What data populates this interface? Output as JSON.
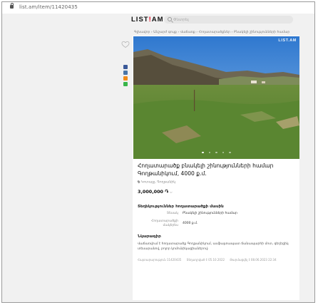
{
  "browser": {
    "url": "list.am/item/11420435"
  },
  "header": {
    "logo_main": "LIST",
    "logo_excl": "!",
    "logo_end": "AM",
    "search_placeholder": "Փնտրել"
  },
  "breadcrumb": "Գլխավոր › Անշարժ գույք › Վաճառք › Հողատարածքներ › Բնակելի շինությունների համար",
  "listing": {
    "photo_watermark": "LIST.AM",
    "title": "Հողատարածք բնակելի շինությունների համար Գողթանիկում, 4000 ք.մ.",
    "location": "Կոտայք, Գողթանիկ",
    "price": "3,000,000 ֏",
    "price_caret": "⌵",
    "params_heading": "Տեղեկություններ հողատարածքի մասին",
    "attributes": [
      {
        "label": "Տեսակ",
        "value": "Բնակելի շինությունների համար"
      },
      {
        "label": "Հողատարածքի մակերես",
        "value": "4000 ք.մ."
      }
    ],
    "description_heading": "Նկարագիր",
    "description": "Վաճառվում է հողատարածք Գողթանիկում, ասֆալտապատ ճանապարհի մոտ, գեղեցիկ տեսարանով, բոլոր կոմունիկացիաներով։",
    "meta": {
      "ad_number": "Հայտարարություն 11420435",
      "posted": "Տեղադրված է 05.10.2022",
      "updated": "Թարմացվել է 08.06.2023 22:34"
    }
  },
  "colors": {
    "brand_red": "#e2001a",
    "facebook": "#3b5998",
    "vk": "#4a76a8",
    "odnoklassniki": "#f28b18",
    "whatsapp": "#39b54a"
  },
  "icons": [
    "lock-icon",
    "search-icon",
    "heart-icon",
    "facebook-icon",
    "vk-icon",
    "odnoklassniki-icon",
    "whatsapp-icon",
    "location-pin-icon"
  ]
}
